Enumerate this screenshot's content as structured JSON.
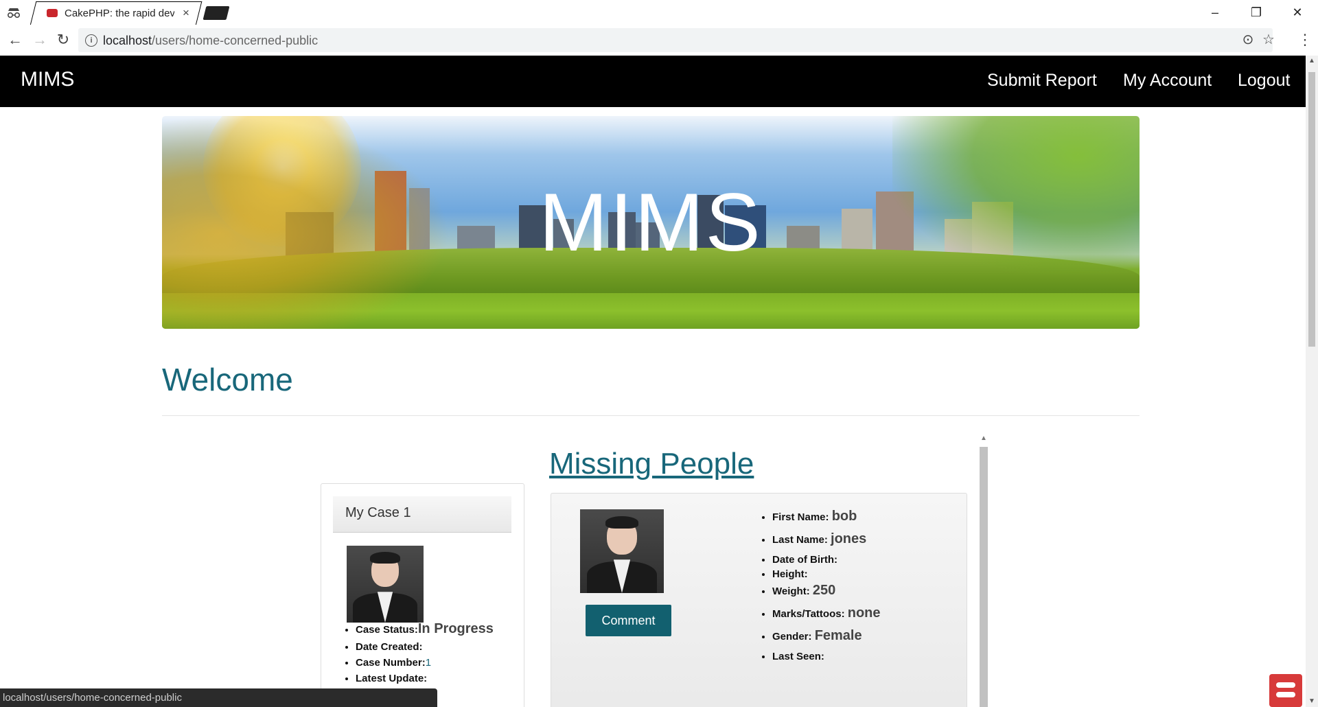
{
  "browser": {
    "tab_title": "CakePHP: the rapid deve",
    "url_host": "localhost",
    "url_path": "/users/home-concerned-public",
    "status_url": "localhost/users/home-concerned-public"
  },
  "navbar": {
    "brand": "MIMS",
    "links": [
      "Submit Report",
      "My Account",
      "Logout"
    ]
  },
  "hero": {
    "title": "MIMS"
  },
  "page": {
    "welcome": "Welcome",
    "missing_title": "Missing People"
  },
  "case": {
    "title": "My Case 1",
    "status_label": "Case Status:",
    "status_value": "In Progress",
    "date_created_label": "Date Created:",
    "case_number_label": "Case Number:",
    "case_number_value": "1",
    "latest_update_label": "Latest Update:"
  },
  "person": {
    "comment_button": "Comment",
    "first_name_label": "First Name:",
    "first_name": "bob",
    "last_name_label": "Last Name:",
    "last_name": "jones",
    "dob_label": "Date of Birth:",
    "height_label": "Height:",
    "weight_label": "Weight:",
    "weight": "250",
    "marks_label": "Marks/Tattoos:",
    "marks": "none",
    "gender_label": "Gender:",
    "gender": "Female",
    "last_seen_label": "Last Seen:"
  },
  "colors": {
    "accent": "#18677a",
    "button": "#12606f",
    "navbar": "#000000"
  }
}
